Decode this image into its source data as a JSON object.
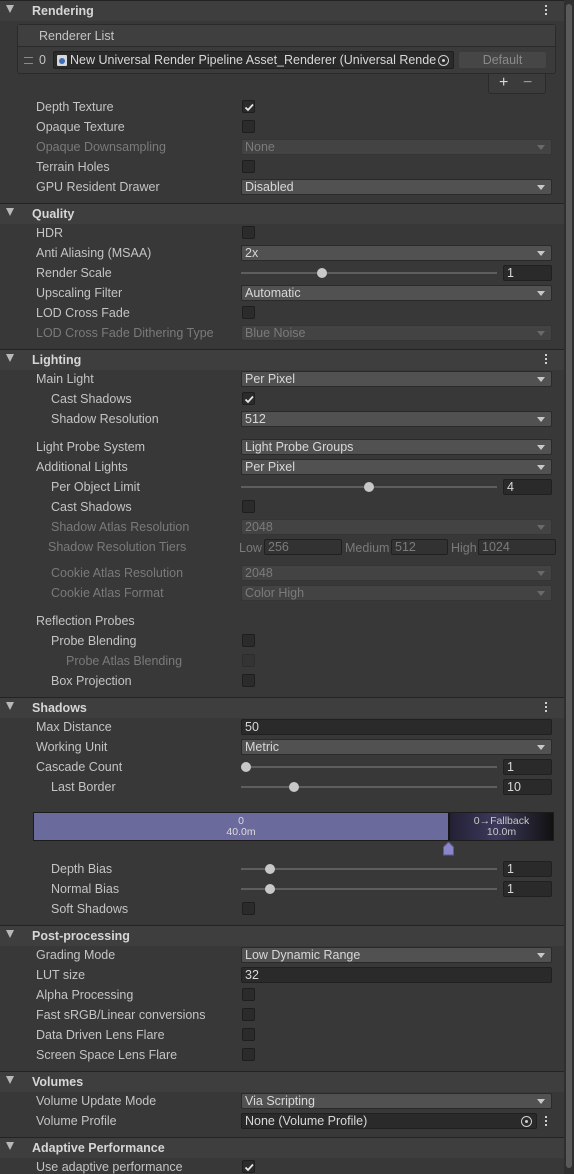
{
  "rendering": {
    "title": "Rendering",
    "renderer_list_label": "Renderer List",
    "renderer_index": "0",
    "renderer_value": "New Universal Render Pipeline Asset_Renderer (Universal Rende",
    "default_label": "Default",
    "add_label": "+",
    "remove_label": "−",
    "depth_texture": "Depth Texture",
    "opaque_texture": "Opaque Texture",
    "opaque_downsampling": "Opaque Downsampling",
    "opaque_downsampling_value": "None",
    "terrain_holes": "Terrain Holes",
    "gpu_resident_drawer": "GPU Resident Drawer",
    "gpu_resident_drawer_value": "Disabled",
    "depth_texture_checked": true
  },
  "quality": {
    "title": "Quality",
    "hdr": "HDR",
    "anti_aliasing": "Anti Aliasing (MSAA)",
    "anti_aliasing_value": "2x",
    "render_scale": "Render Scale",
    "render_scale_value": "1",
    "upscaling_filter": "Upscaling Filter",
    "upscaling_filter_value": "Automatic",
    "lod_cross_fade": "LOD Cross Fade",
    "lod_dither": "LOD Cross Fade Dithering Type",
    "lod_dither_value": "Blue Noise"
  },
  "lighting": {
    "title": "Lighting",
    "main_light": "Main Light",
    "main_light_value": "Per Pixel",
    "cast_shadows": "Cast Shadows",
    "shadow_resolution": "Shadow Resolution",
    "shadow_resolution_value": "512",
    "light_probe_system": "Light Probe System",
    "light_probe_system_value": "Light Probe Groups",
    "additional_lights": "Additional Lights",
    "additional_lights_value": "Per Pixel",
    "per_object_limit": "Per Object Limit",
    "per_object_limit_value": "4",
    "add_cast_shadows": "Cast Shadows",
    "shadow_atlas_resolution": "Shadow Atlas Resolution",
    "shadow_atlas_resolution_value": "2048",
    "shadow_resolution_tiers": "Shadow Resolution Tiers",
    "tier_low_label": "Low",
    "tier_low_value": "256",
    "tier_medium_label": "Medium",
    "tier_medium_value": "512",
    "tier_high_label": "High",
    "tier_high_value": "1024",
    "cookie_atlas_resolution": "Cookie Atlas Resolution",
    "cookie_atlas_resolution_value": "2048",
    "cookie_atlas_format": "Cookie Atlas Format",
    "cookie_atlas_format_value": "Color High",
    "reflection_probes": "Reflection Probes",
    "probe_blending": "Probe Blending",
    "probe_atlas_blending": "Probe Atlas Blending",
    "box_projection": "Box Projection",
    "main_cast_shadows_checked": true
  },
  "shadows": {
    "title": "Shadows",
    "max_distance": "Max Distance",
    "max_distance_value": "50",
    "working_unit": "Working Unit",
    "working_unit_value": "Metric",
    "cascade_count": "Cascade Count",
    "cascade_count_value": "1",
    "last_border": "Last Border",
    "last_border_value": "10",
    "cascade0_index": "0",
    "cascade0_distance": "40.0m",
    "fallback_label": "0→Fallback",
    "fallback_distance": "10.0m",
    "depth_bias": "Depth Bias",
    "depth_bias_value": "1",
    "normal_bias": "Normal Bias",
    "normal_bias_value": "1",
    "soft_shadows": "Soft Shadows"
  },
  "post_processing": {
    "title": "Post-processing",
    "grading_mode": "Grading Mode",
    "grading_mode_value": "Low Dynamic Range",
    "lut_size": "LUT size",
    "lut_size_value": "32",
    "alpha_processing": "Alpha Processing",
    "fast_srgb": "Fast sRGB/Linear conversions",
    "data_driven_lens_flare": "Data Driven Lens Flare",
    "screen_space_lens_flare": "Screen Space Lens Flare"
  },
  "volumes": {
    "title": "Volumes",
    "volume_update_mode": "Volume Update Mode",
    "volume_update_mode_value": "Via Scripting",
    "volume_profile": "Volume Profile",
    "volume_profile_value": "None (Volume Profile)"
  },
  "adaptive": {
    "title": "Adaptive Performance",
    "use_adaptive": "Use adaptive performance",
    "use_adaptive_checked": true
  },
  "colors": {
    "background": "#383838",
    "header": "#3e3e3e",
    "cascade_fill": "#6b6a9d",
    "text": "#c4c4c4",
    "disabled_text": "#7a7a7a"
  },
  "sliders": {
    "render_scale": 0.32,
    "per_object_limit": 0.5,
    "cascade_count": 0.0,
    "last_border": 0.2,
    "depth_bias": 0.12,
    "normal_bias": 0.12
  }
}
